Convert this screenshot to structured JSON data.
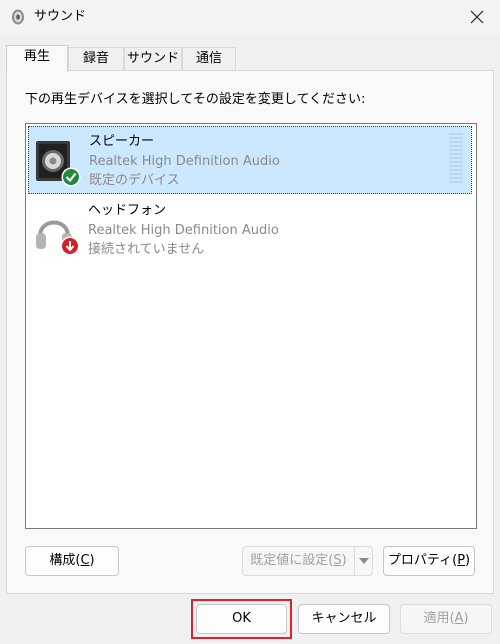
{
  "window": {
    "title": "サウンド",
    "close_icon": "close-icon"
  },
  "tabs": [
    {
      "label": "再生",
      "active": true
    },
    {
      "label": "録音",
      "active": false
    },
    {
      "label": "サウンド",
      "active": false
    },
    {
      "label": "通信",
      "active": false
    }
  ],
  "panel": {
    "instruction": "下の再生デバイスを選択してその設定を変更してください:"
  },
  "devices": [
    {
      "name": "スピーカー",
      "driver": "Realtek High Definition Audio",
      "status": "既定のデバイス",
      "icon": "speaker-icon",
      "badge": "default-check-icon",
      "selected": true
    },
    {
      "name": "ヘッドフォン",
      "driver": "Realtek High Definition Audio",
      "status": "接続されていません",
      "icon": "headphones-icon",
      "badge": "disconnected-arrow-icon",
      "selected": false
    }
  ],
  "panel_buttons": {
    "configure": {
      "text": "構成(",
      "key": "C",
      "end": ")"
    },
    "set_default": {
      "text": "既定値に設定(",
      "key": "S",
      "end": ")"
    },
    "properties": {
      "text": "プロパティ(",
      "key": "P",
      "end": ")"
    }
  },
  "dialog_buttons": {
    "ok": "OK",
    "cancel": "キャンセル",
    "apply": {
      "text": "適用(",
      "key": "A",
      "end": ")"
    }
  },
  "colors": {
    "selection": "#cce8ff",
    "highlight_border": "#e0202a",
    "default_badge": "#1e8a3a",
    "disconnected_badge": "#d0202a"
  }
}
